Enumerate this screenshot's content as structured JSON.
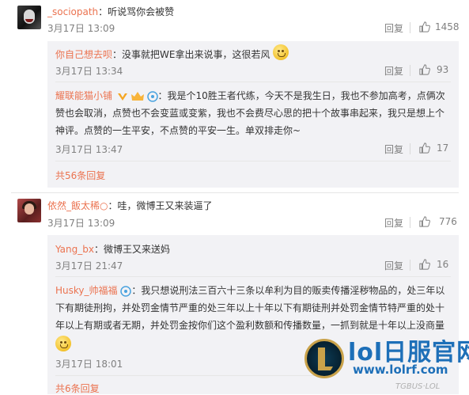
{
  "comments": [
    {
      "name": "_sociopath",
      "sep": "：",
      "text": "听说骂你会被赞",
      "time": "3月17日 13:09",
      "reply_label": "回复",
      "likes": "1458"
    },
    {
      "name": "依然_飯太稀○",
      "sep": "：",
      "text": "哇，微博王又来装逼了",
      "time": "3月17日 13:09",
      "reply_label": "回复",
      "likes": "776"
    }
  ],
  "replies_1": [
    {
      "name": "你自己想去呗",
      "sep": "：",
      "text": "没事就把WE拿出来说事，这很若风",
      "time": "3月17日 13:34",
      "reply_label": "回复",
      "likes": "93"
    },
    {
      "name": "耀联能猫小铺",
      "sep": "：",
      "text_lines": [
        "我是个10胜王者代练，今天不是我生日，我也不参加高考，点俩次",
        "赞也会取消，点赞也不会变蓝或变紫，我也不会费尽心思的把十个故事串起来，我只是想上个",
        "神评。点赞的一生平安，不点赞的平安一生。单双排走你~"
      ],
      "time": "3月17日 13:47",
      "reply_label": "回复",
      "likes": "17"
    }
  ],
  "more_1": "共56条回复",
  "replies_2": [
    {
      "name": "Yang_bx",
      "sep": "：",
      "text": "微博王又来送妈",
      "time": "3月17日 21:47",
      "reply_label": "回复",
      "likes": "16"
    },
    {
      "name": "Husky_帅福福",
      "sep": "：",
      "text_lines": [
        "我只想说刑法三百六十三条以牟利为目的贩卖传播淫秽物品的，处三年以",
        "下有期徒刑拘，并处罚金情节严重的处三年以上十年以下有期徒刑并处罚金情节特严重的处十",
        "年以上有期或者无期，并处罚金按你们这个盈利数额和传播数量，一抓到就是十年以上没商量"
      ],
      "time": "3月17日 18:01",
      "reply_label": "",
      "likes": ""
    }
  ],
  "more_2": "共6条回复",
  "watermark": {
    "title": "lol日服官网",
    "url": "www.lolrf.com",
    "small": "TGBUS·LOL"
  },
  "colors": {
    "name": "#eb7350",
    "reply_bg": "#f2f2f5",
    "watermark": "#1d6fb8"
  },
  "icons": {
    "like": "thumbs-up-icon",
    "smile": "smile-emoji-icon",
    "vip": "vip-badge-icon"
  }
}
